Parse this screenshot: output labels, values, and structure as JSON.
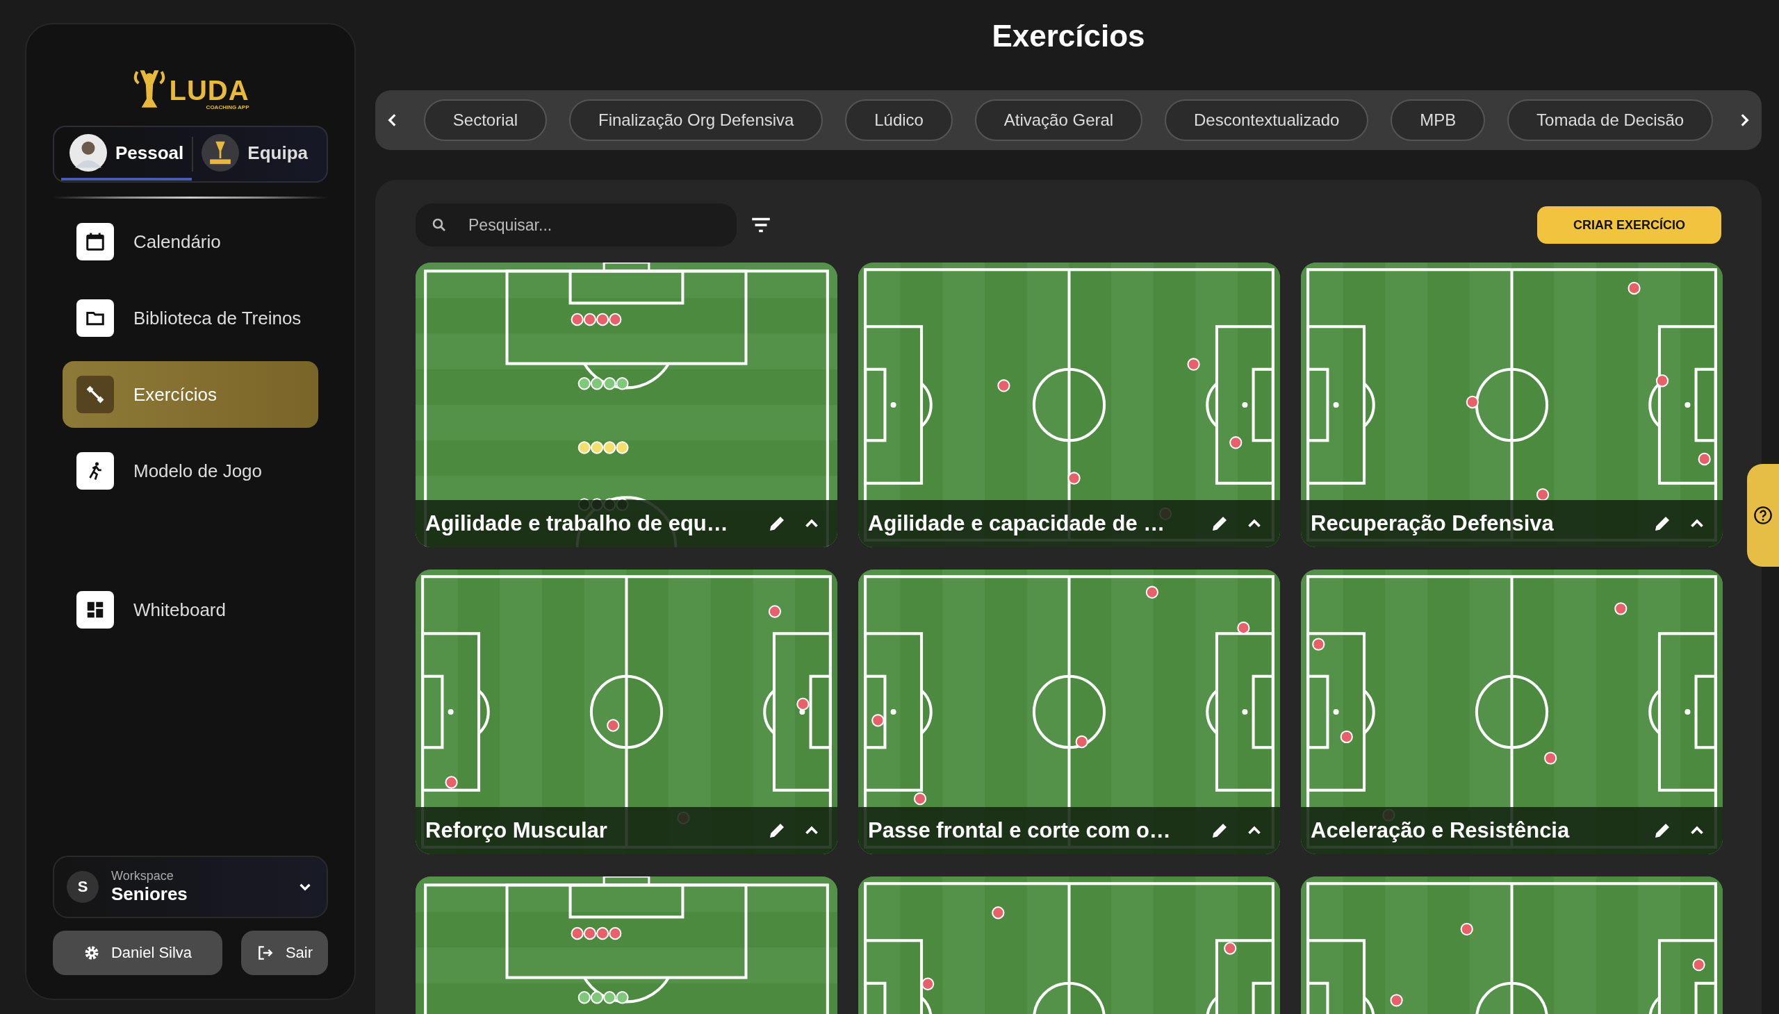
{
  "sidebar": {
    "logo": {
      "name": "LUDA",
      "tagline": "COACHING APP"
    },
    "profiles": [
      {
        "label": "Pessoal",
        "selected": true
      },
      {
        "label": "Equipa",
        "selected": false
      }
    ],
    "nav": [
      {
        "label": "Calendário",
        "selected": false
      },
      {
        "label": "Biblioteca de Treinos",
        "selected": false
      },
      {
        "label": "Exercícios",
        "selected": true
      },
      {
        "label": "Modelo de Jogo",
        "selected": false
      }
    ],
    "tools": [
      {
        "label": "Whiteboard",
        "selected": false
      }
    ],
    "workspace": {
      "initial": "S",
      "label": "Workspace",
      "name": "Seniores"
    },
    "user_button": "Daniel Silva",
    "logout_button": "Sair"
  },
  "page_title": "Exercícios",
  "categories": [
    {
      "label": "Sectorial",
      "selected": false
    },
    {
      "label": "Finalização Org Defensiva",
      "selected": false
    },
    {
      "label": "Lúdico",
      "selected": false
    },
    {
      "label": "Ativação Geral",
      "selected": false
    },
    {
      "label": "Descontextualizado",
      "selected": false
    },
    {
      "label": "MPB",
      "selected": false
    },
    {
      "label": "Tomada de Decisão",
      "selected": false
    }
  ],
  "search": {
    "placeholder": "Pesquisar..."
  },
  "create_button": "CRIAR EXERCÍCIO",
  "exercises": [
    {
      "title": "Agilidade e trabalho de equ…",
      "kind": "half"
    },
    {
      "title": "Agilidade  e capacidade de …",
      "kind": "full"
    },
    {
      "title": "Recuperação Defensiva",
      "kind": "full"
    },
    {
      "title": "Reforço Muscular",
      "kind": "full"
    },
    {
      "title": "Passe frontal e corte com o…",
      "kind": "full"
    },
    {
      "title": "Aceleração e Resistência",
      "kind": "full"
    },
    {
      "kind": "half"
    },
    {
      "kind": "full"
    },
    {
      "kind": "full"
    }
  ]
}
